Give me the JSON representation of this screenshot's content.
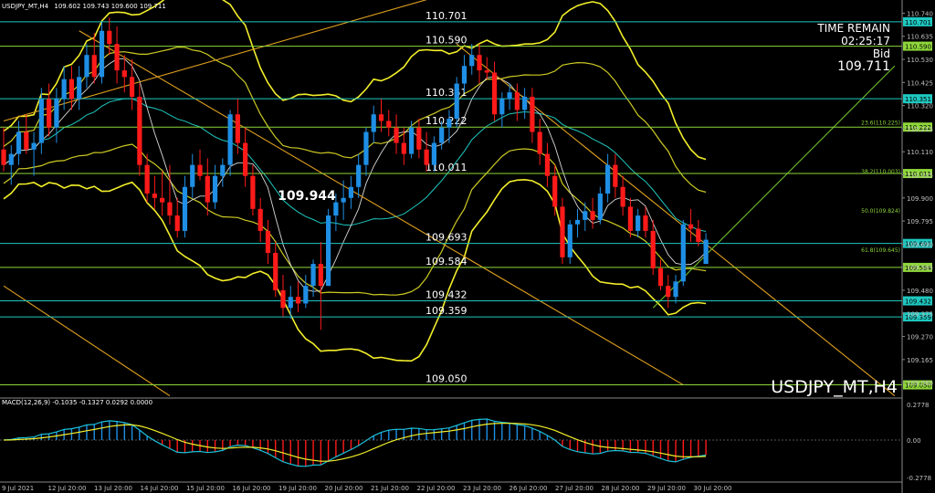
{
  "colors": {
    "background": "#000000",
    "bull": "#1f8fe5",
    "bear": "#ff1a1a",
    "level_line": "#1ec8c0",
    "fib_line": "#8ed63a",
    "envelope": "#f2ee2a",
    "trendline": "#e0a020",
    "green_trend": "#6ac02a",
    "text": "#ffffff",
    "grid_tick": "#c0c0c0",
    "macd_signal": "#f2ee2a",
    "macd_line": "#19c0d8"
  },
  "chart_data": {
    "type": "candlestick",
    "symbol_header": "USDJPY_MT,H4",
    "header_values": "109.602 109.743 109.600 109.711",
    "watermark": "USDJPY_MT,H4",
    "time_remain_label": "TIME REMAIN",
    "time_remain_value": "02:25:17",
    "bid_label": "Bid",
    "bid_value": "109.711",
    "y_range": [
      108.99,
      110.8
    ],
    "y_ticks": [
      "110.740",
      "110.635",
      "110.530",
      "110.425",
      "110.320",
      "110.215",
      "110.110",
      "110.005",
      "109.900",
      "109.795",
      "109.690",
      "109.585",
      "109.480",
      "109.375",
      "109.270",
      "109.165",
      "109.060"
    ],
    "x_labels": [
      "9 Jul 2021",
      "12 Jul 20:00",
      "13 Jul 20:00",
      "14 Jul 20:00",
      "15 Jul 20:00",
      "16 Jul 20:00",
      "19 Jul 20:00",
      "20 Jul 20:00",
      "21 Jul 20:00",
      "22 Jul 20:00",
      "23 Jul 20:00",
      "26 Jul 20:00",
      "27 Jul 20:00",
      "28 Jul 20:00",
      "29 Jul 20:00",
      "30 Jul 20:00"
    ],
    "levels": [
      {
        "value": 110.701,
        "label": "110.701",
        "tag": "110.701",
        "color": "#1ec8c0"
      },
      {
        "value": 110.59,
        "label": "110.590",
        "tag": "110.590",
        "color": "#8ed63a"
      },
      {
        "value": 110.351,
        "label": "110.351",
        "tag": "110.351",
        "color": "#1ec8c0"
      },
      {
        "value": 110.222,
        "label": "110.222",
        "tag": "110.222",
        "color": "#8ed63a"
      },
      {
        "value": 110.011,
        "label": "110.011",
        "tag": "110.011",
        "color": "#8ed63a"
      },
      {
        "value": 109.693,
        "label": "109.693",
        "tag": "109.693",
        "color": "#1ec8c0"
      },
      {
        "value": 109.584,
        "label": "109.584",
        "tag": "109.584",
        "color": "#8ed63a"
      },
      {
        "value": 109.432,
        "label": "109.432",
        "tag": "109.432",
        "color": "#1ec8c0"
      },
      {
        "value": 109.359,
        "label": "109.359",
        "tag": "109.359",
        "color": "#1ec8c0"
      },
      {
        "value": 109.05,
        "label": "109.050",
        "tag": "109.050",
        "color": "#8ed63a"
      }
    ],
    "fib_levels": [
      {
        "value": 110.225,
        "label": "23.6(110.225)"
      },
      {
        "value": 110.003,
        "label": "38.2(110.003)"
      },
      {
        "value": 109.824,
        "label": "50.0(109.824)"
      },
      {
        "value": 109.645,
        "label": "61.8(109.645)"
      }
    ],
    "highlight_price": {
      "value": 109.944,
      "label": "109.944"
    },
    "candles": [
      [
        110.12,
        110.22,
        110.02,
        110.05
      ],
      [
        110.05,
        110.14,
        109.96,
        110.1
      ],
      [
        110.1,
        110.25,
        110.05,
        110.2
      ],
      [
        110.2,
        110.28,
        110.1,
        110.12
      ],
      [
        110.12,
        110.2,
        110.0,
        110.15
      ],
      [
        110.15,
        110.4,
        110.1,
        110.35
      ],
      [
        110.35,
        110.42,
        110.18,
        110.22
      ],
      [
        110.22,
        110.4,
        110.15,
        110.35
      ],
      [
        110.35,
        110.5,
        110.3,
        110.44
      ],
      [
        110.44,
        110.5,
        110.3,
        110.35
      ],
      [
        110.35,
        110.5,
        110.3,
        110.45
      ],
      [
        110.45,
        110.6,
        110.4,
        110.55
      ],
      [
        110.55,
        110.65,
        110.42,
        110.45
      ],
      [
        110.45,
        110.7,
        110.42,
        110.66
      ],
      [
        110.66,
        110.72,
        110.55,
        110.6
      ],
      [
        110.6,
        110.68,
        110.42,
        110.48
      ],
      [
        110.48,
        110.55,
        110.38,
        110.45
      ],
      [
        110.45,
        110.53,
        110.3,
        110.36
      ],
      [
        110.36,
        110.42,
        110.0,
        110.05
      ],
      [
        110.05,
        110.1,
        109.88,
        109.92
      ],
      [
        109.92,
        110.0,
        109.85,
        109.9
      ],
      [
        109.9,
        110.02,
        109.82,
        109.88
      ],
      [
        109.88,
        110.05,
        109.78,
        109.82
      ],
      [
        109.82,
        109.9,
        109.72,
        109.75
      ],
      [
        109.75,
        110.0,
        109.72,
        109.95
      ],
      [
        109.95,
        110.1,
        109.9,
        110.05
      ],
      [
        110.05,
        110.12,
        109.98,
        110.0
      ],
      [
        110.0,
        110.08,
        109.82,
        109.88
      ],
      [
        109.88,
        110.05,
        109.85,
        110.0
      ],
      [
        110.0,
        110.08,
        109.95,
        110.05
      ],
      [
        110.05,
        110.3,
        110.0,
        110.28
      ],
      [
        110.28,
        110.35,
        110.1,
        110.15
      ],
      [
        110.15,
        110.22,
        109.95,
        110.0
      ],
      [
        110.0,
        110.05,
        109.82,
        109.85
      ],
      [
        109.85,
        109.9,
        109.7,
        109.75
      ],
      [
        109.75,
        109.8,
        109.6,
        109.65
      ],
      [
        109.65,
        109.7,
        109.45,
        109.48
      ],
      [
        109.48,
        109.55,
        109.36,
        109.4
      ],
      [
        109.4,
        109.5,
        109.35,
        109.45
      ],
      [
        109.45,
        109.52,
        109.38,
        109.42
      ],
      [
        109.42,
        109.55,
        109.4,
        109.5
      ],
      [
        109.5,
        109.62,
        109.45,
        109.6
      ],
      [
        109.6,
        109.7,
        109.3,
        109.5
      ],
      [
        109.5,
        109.85,
        109.5,
        109.82
      ],
      [
        109.82,
        109.92,
        109.75,
        109.88
      ],
      [
        109.88,
        109.98,
        109.8,
        109.9
      ],
      [
        109.9,
        110.0,
        109.85,
        109.95
      ],
      [
        109.95,
        110.1,
        109.9,
        110.05
      ],
      [
        110.05,
        110.22,
        110.0,
        110.2
      ],
      [
        110.2,
        110.32,
        110.15,
        110.28
      ],
      [
        110.28,
        110.35,
        110.2,
        110.25
      ],
      [
        110.25,
        110.3,
        110.18,
        110.22
      ],
      [
        110.22,
        110.28,
        110.1,
        110.15
      ],
      [
        110.15,
        110.22,
        110.05,
        110.1
      ],
      [
        110.1,
        110.25,
        110.08,
        110.22
      ],
      [
        110.22,
        110.26,
        110.08,
        110.12
      ],
      [
        110.12,
        110.2,
        110.02,
        110.05
      ],
      [
        110.05,
        110.18,
        110.02,
        110.15
      ],
      [
        110.15,
        110.25,
        110.12,
        110.22
      ],
      [
        110.22,
        110.3,
        110.15,
        110.26
      ],
      [
        110.26,
        110.45,
        110.22,
        110.42
      ],
      [
        110.42,
        110.55,
        110.38,
        110.5
      ],
      [
        110.5,
        110.6,
        110.46,
        110.55
      ],
      [
        110.55,
        110.6,
        110.42,
        110.48
      ],
      [
        110.48,
        110.54,
        110.44,
        110.47
      ],
      [
        110.47,
        110.52,
        110.25,
        110.28
      ],
      [
        110.28,
        110.38,
        110.22,
        110.35
      ],
      [
        110.35,
        110.42,
        110.3,
        110.38
      ],
      [
        110.38,
        110.42,
        110.25,
        110.3
      ],
      [
        110.3,
        110.4,
        110.26,
        110.36
      ],
      [
        110.36,
        110.4,
        110.15,
        110.2
      ],
      [
        110.2,
        110.26,
        110.05,
        110.1
      ],
      [
        110.1,
        110.15,
        109.95,
        110.0
      ],
      [
        110.0,
        110.05,
        109.82,
        109.86
      ],
      [
        109.86,
        109.9,
        109.6,
        109.63
      ],
      [
        109.63,
        109.8,
        109.6,
        109.78
      ],
      [
        109.78,
        109.85,
        109.72,
        109.8
      ],
      [
        109.8,
        109.88,
        109.75,
        109.84
      ],
      [
        109.84,
        109.9,
        109.76,
        109.8
      ],
      [
        109.8,
        109.95,
        109.78,
        109.92
      ],
      [
        109.92,
        110.1,
        109.88,
        110.05
      ],
      [
        110.05,
        110.1,
        109.9,
        109.95
      ],
      [
        109.95,
        110.0,
        109.82,
        109.86
      ],
      [
        109.86,
        109.9,
        109.72,
        109.75
      ],
      [
        109.75,
        109.85,
        109.72,
        109.82
      ],
      [
        109.82,
        109.86,
        109.72,
        109.75
      ],
      [
        109.75,
        109.8,
        109.55,
        109.58
      ],
      [
        109.58,
        109.62,
        109.48,
        109.5
      ],
      [
        109.5,
        109.55,
        109.4,
        109.45
      ],
      [
        109.45,
        109.55,
        109.42,
        109.52
      ],
      [
        109.52,
        109.8,
        109.5,
        109.78
      ],
      [
        109.78,
        109.85,
        109.7,
        109.76
      ],
      [
        109.76,
        109.8,
        109.68,
        109.7
      ],
      [
        109.6,
        109.74,
        109.6,
        109.71
      ]
    ],
    "macd": {
      "label": "MACD(12,26,9) -0.1035 -0.1327 0.0292 0.0000",
      "y_range": [
        -0.2778,
        0.2778
      ],
      "y_ticks": [
        "0.2778",
        "0.00",
        "-0.2778"
      ]
    }
  }
}
